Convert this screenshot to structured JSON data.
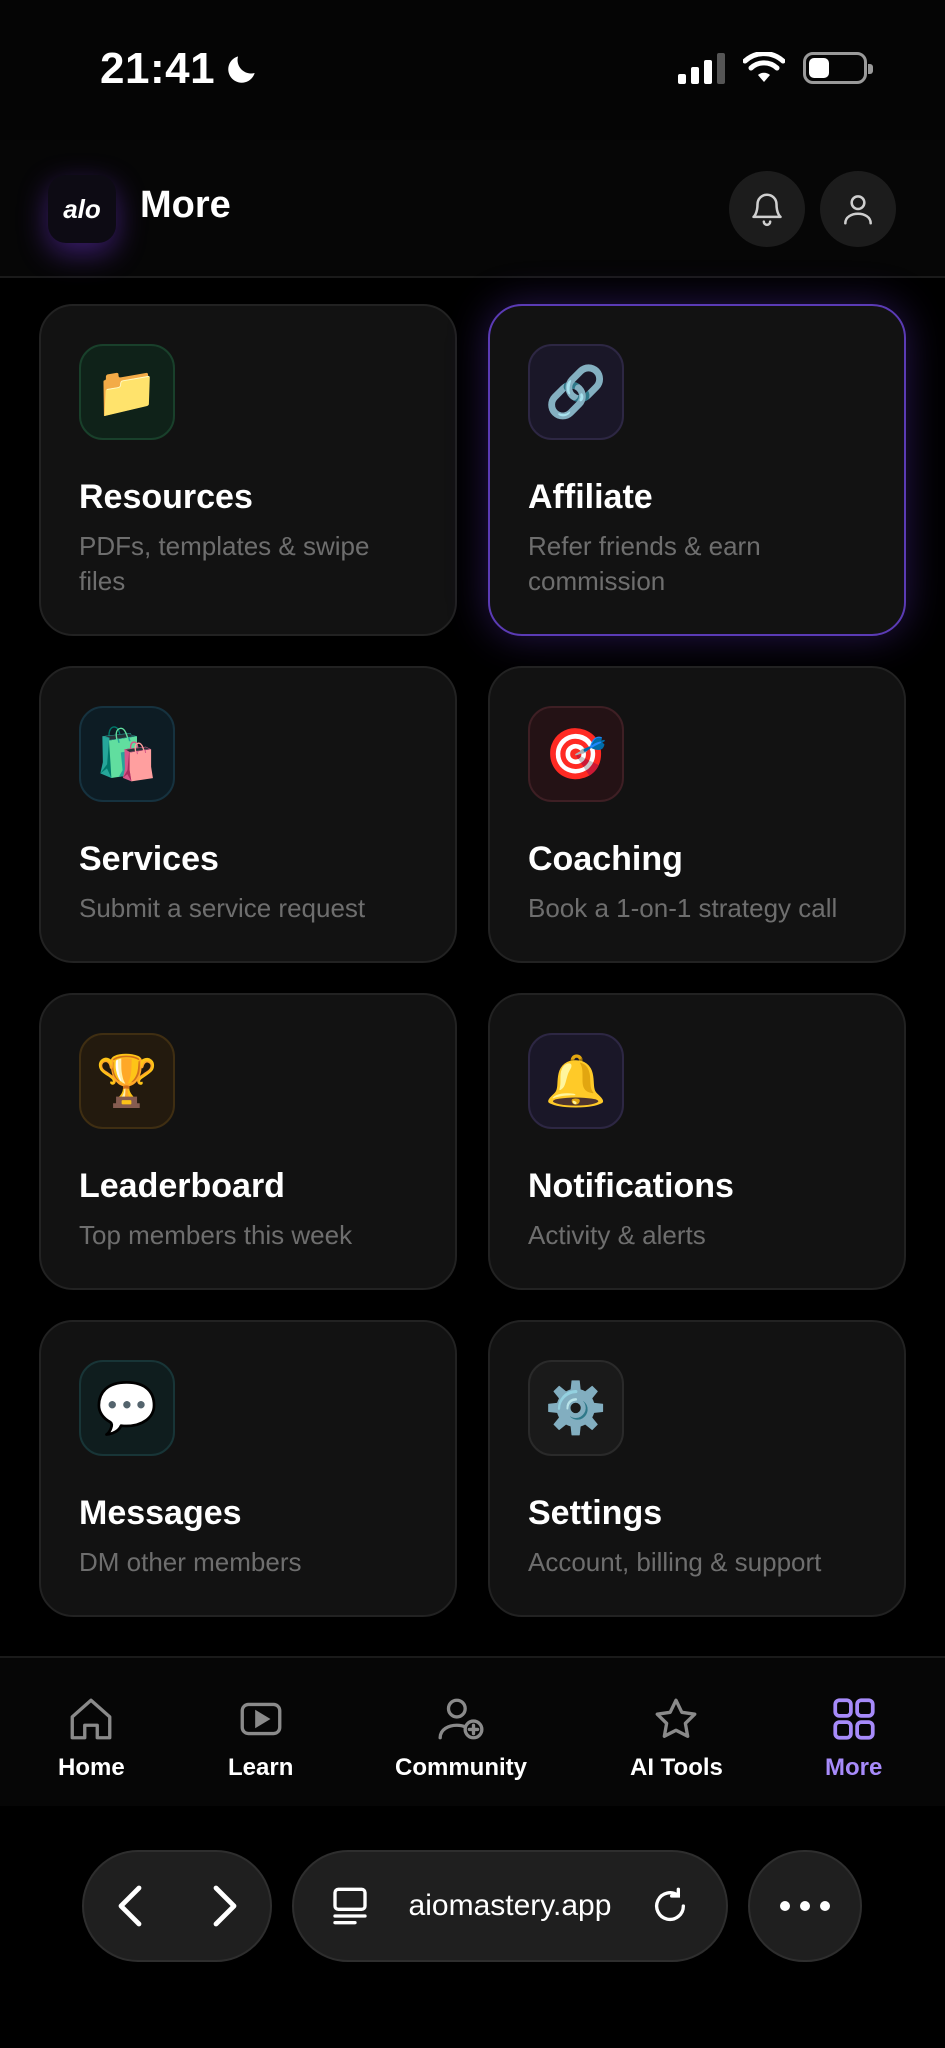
{
  "status": {
    "time": "21:41"
  },
  "header": {
    "title": "More",
    "logo_text": "alo"
  },
  "cards": [
    {
      "icon": "📁",
      "title": "Resources",
      "subtitle": "PDFs, templates & swipe files"
    },
    {
      "icon": "🔗",
      "title": "Affiliate",
      "subtitle": "Refer friends & earn commission"
    },
    {
      "icon": "🛍️",
      "title": "Services",
      "subtitle": "Submit a service request"
    },
    {
      "icon": "🎯",
      "title": "Coaching",
      "subtitle": "Book a 1-on-1 strategy call"
    },
    {
      "icon": "🏆",
      "title": "Leaderboard",
      "subtitle": "Top members this week"
    },
    {
      "icon": "🔔",
      "title": "Notifications",
      "subtitle": "Activity & alerts"
    },
    {
      "icon": "💬",
      "title": "Messages",
      "subtitle": "DM other members"
    },
    {
      "icon": "⚙️",
      "title": "Settings",
      "subtitle": "Account, billing & support"
    }
  ],
  "nav": [
    {
      "label": "Home",
      "icon": "home-icon"
    },
    {
      "label": "Learn",
      "icon": "play-icon"
    },
    {
      "label": "Community",
      "icon": "user-plus-icon"
    },
    {
      "label": "AI Tools",
      "icon": "star-icon"
    },
    {
      "label": "More",
      "icon": "grid-icon",
      "active": true
    }
  ],
  "browser": {
    "url": "aiomastery.app"
  },
  "colors": {
    "accent": "#a78bfa",
    "highlight_border": "#5b3bb5",
    "card_bg": "#121212"
  }
}
